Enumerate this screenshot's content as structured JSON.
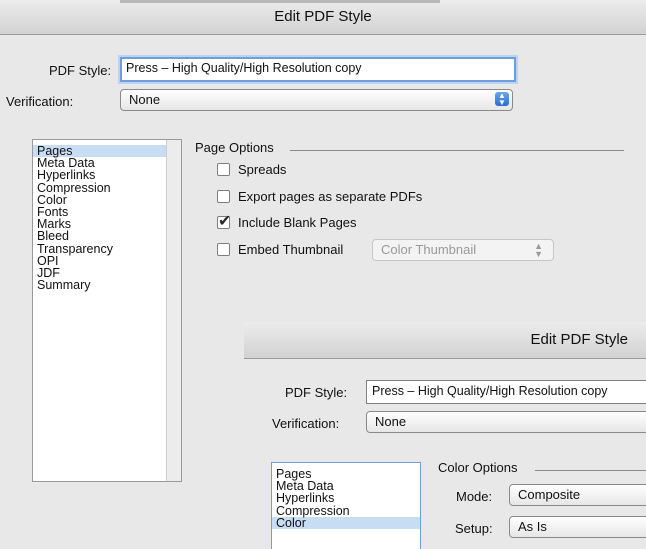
{
  "main_window": {
    "title": "Edit PDF Style",
    "pdf_style_label": "PDF Style:",
    "pdf_style_value": "Press – High Quality/High Resolution copy",
    "verification_label": "Verification:",
    "verification_value": "None",
    "sidebar": [
      {
        "label": "Pages",
        "selected": true
      },
      {
        "label": "Meta Data"
      },
      {
        "label": "Hyperlinks"
      },
      {
        "label": "Compression"
      },
      {
        "label": "Color"
      },
      {
        "label": "Fonts"
      },
      {
        "label": "Marks"
      },
      {
        "label": "Bleed"
      },
      {
        "label": "Transparency"
      },
      {
        "label": "OPI"
      },
      {
        "label": "JDF"
      },
      {
        "label": "Summary"
      }
    ],
    "page_options": {
      "title": "Page Options",
      "spreads": "Spreads",
      "export_separate": "Export pages as separate PDFs",
      "include_blank": "Include Blank Pages",
      "embed_thumbnail": "Embed Thumbnail",
      "thumbnail_select": "Color Thumbnail"
    }
  },
  "second_window": {
    "title": "Edit PDF Style",
    "pdf_style_label": "PDF Style:",
    "pdf_style_value": "Press – High Quality/High Resolution copy",
    "verification_label": "Verification:",
    "verification_value": "None",
    "sidebar": [
      {
        "label": "Pages"
      },
      {
        "label": "Meta Data"
      },
      {
        "label": "Hyperlinks"
      },
      {
        "label": "Compression"
      },
      {
        "label": "Color",
        "selected": true
      }
    ],
    "color_options": {
      "title": "Color Options",
      "mode_label": "Mode:",
      "mode_value": "Composite",
      "setup_label": "Setup:",
      "setup_value": "As Is"
    }
  }
}
